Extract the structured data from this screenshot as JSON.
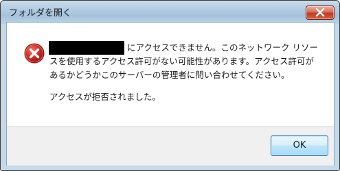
{
  "window": {
    "title": "フォルダを開く"
  },
  "message": {
    "line1": "にアクセスできません。このネットワーク リソー",
    "line2": "スを使用するアクセス許可がない可能性があります。アクセス許可が",
    "line3": "あるかどうかこのサーバーの管理者に問い合わせてください。",
    "line4": "アクセスが拒否されました。"
  },
  "buttons": {
    "ok_label": "OK"
  },
  "icons": {
    "error": "error-icon",
    "close": "close-icon"
  },
  "colors": {
    "error_red": "#c8201f",
    "close_red": "#c9452b",
    "ok_border": "#3c7fb1"
  }
}
